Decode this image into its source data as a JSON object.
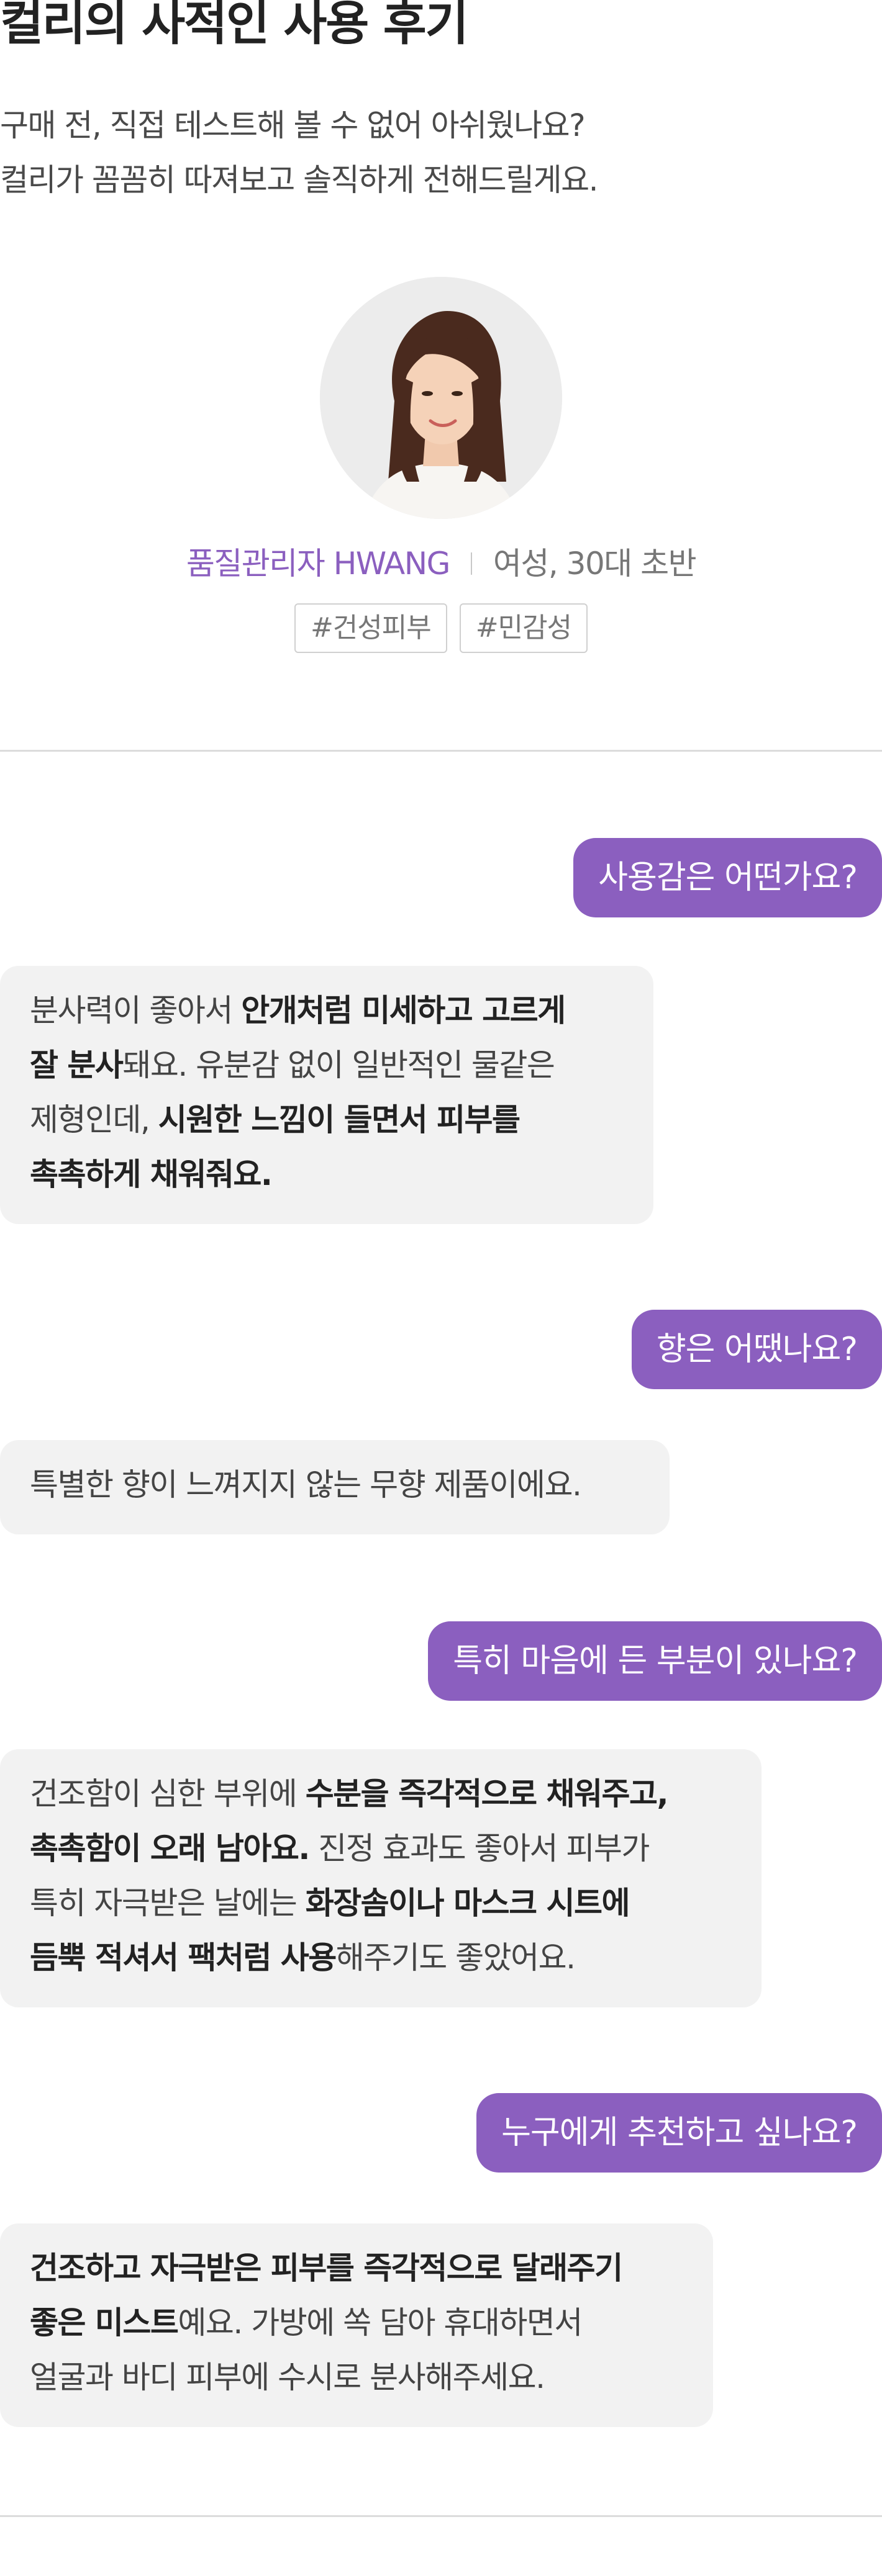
{
  "header": {
    "title": "컬리의 사적인 사용 후기",
    "intro_line1": "구매 전, 직접 테스트해 볼 수 없어 아쉬웠나요?",
    "intro_line2": "컬리가 꼼꼼히 따져보고 솔직하게 전해드릴게요."
  },
  "reviewer": {
    "name": "품질관리자 HWANG",
    "demographic": "여성, 30대 초반",
    "tags": [
      "#건성피부",
      "#민감성"
    ]
  },
  "colors": {
    "accent": "#8b5fbf",
    "bubble_bg": "#f2f2f2",
    "divider": "#dcdcdc"
  },
  "conversation": [
    {
      "question": "사용감은 어떤가요?",
      "answer_lines": [
        [
          {
            "t": "분사력이 좋아서 ",
            "b": false
          },
          {
            "t": "안개처럼 미세하고 고르게",
            "b": true
          }
        ],
        [
          {
            "t": "잘 분사",
            "b": true
          },
          {
            "t": "돼요. 유분감 없이 일반적인 물같은",
            "b": false
          }
        ],
        [
          {
            "t": "제형인데, ",
            "b": false
          },
          {
            "t": "시원한 느낌이 들면서 피부를",
            "b": true
          }
        ],
        [
          {
            "t": "촉촉하게 채워줘요.",
            "b": true
          }
        ]
      ]
    },
    {
      "question": "향은 어땠나요?",
      "answer_lines": [
        [
          {
            "t": "특별한 향이 느껴지지 않는 무향 제품이에요.",
            "b": false
          }
        ]
      ]
    },
    {
      "question": "특히 마음에 든 부분이 있나요?",
      "answer_lines": [
        [
          {
            "t": "건조함이 심한 부위에 ",
            "b": false
          },
          {
            "t": "수분을 즉각적으로 채워주고,",
            "b": true
          }
        ],
        [
          {
            "t": "촉촉함이 오래 남아요.",
            "b": true
          },
          {
            "t": " 진정 효과도 좋아서 피부가",
            "b": false
          }
        ],
        [
          {
            "t": "특히 자극받은 날에는 ",
            "b": false
          },
          {
            "t": "화장솜이나 마스크 시트에",
            "b": true
          }
        ],
        [
          {
            "t": "듬뿍 적셔서 팩처럼 사용",
            "b": true
          },
          {
            "t": "해주기도 좋았어요.",
            "b": false
          }
        ]
      ]
    },
    {
      "question": "누구에게 추천하고 싶나요?",
      "answer_lines": [
        [
          {
            "t": "건조하고 자극받은 피부를 즉각적으로 달래주기",
            "b": true
          }
        ],
        [
          {
            "t": "좋은 미스트",
            "b": true
          },
          {
            "t": "예요. 가방에 쏙 담아 휴대하면서",
            "b": false
          }
        ],
        [
          {
            "t": "얼굴과 바디 피부에 수시로 분사해주세요.",
            "b": false
          }
        ]
      ]
    }
  ]
}
